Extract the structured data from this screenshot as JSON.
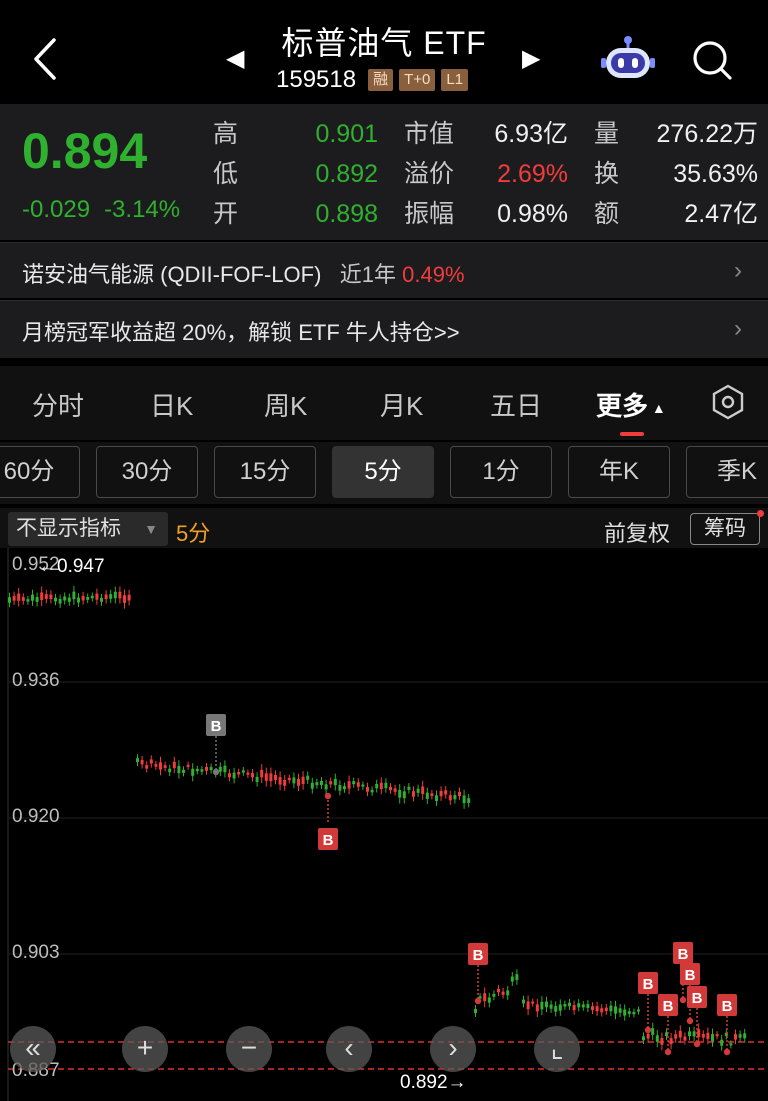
{
  "header": {
    "title": "标普油气 ETF",
    "code": "159518",
    "tags": [
      "融",
      "T+0",
      "L1"
    ]
  },
  "quote": {
    "price": "0.894",
    "change": "-0.029",
    "change_pct": "-3.14%",
    "high_label": "高",
    "high": "0.901",
    "low_label": "低",
    "low": "0.892",
    "open_label": "开",
    "open": "0.898",
    "mktcap_label": "市值",
    "mktcap": "6.93亿",
    "premium_label": "溢价",
    "premium": "2.69%",
    "amplitude_label": "振幅",
    "amplitude": "0.98%",
    "volume_label": "量",
    "volume": "276.22万",
    "turnover_label": "换",
    "turnover": "35.63%",
    "amount_label": "额",
    "amount": "2.47亿"
  },
  "fund_row": {
    "name": "诺安油气能源 (QDII-FOF-LOF)",
    "period": "近1年",
    "return": "0.49%"
  },
  "promo_row": {
    "text": "月榜冠军收益超 20%，解锁 ETF 牛人持仓>>"
  },
  "tabs": [
    "分时",
    "日K",
    "周K",
    "月K",
    "五日",
    "更多"
  ],
  "periods": [
    "60分",
    "30分",
    "15分",
    "5分",
    "1分",
    "年K",
    "季K"
  ],
  "subbar": {
    "indicator": "不显示指标",
    "period": "5分",
    "adjust": "前复权",
    "chips": "筹码"
  },
  "chart_data": {
    "type": "candlestick",
    "y_ticks": [
      "0.952",
      "0.936",
      "0.920",
      "0.903",
      "0.887"
    ],
    "ylim": [
      0.887,
      0.952
    ],
    "max_label": "←0.947",
    "min_label": "0.892→",
    "trade_marks": [
      "B",
      "B",
      "B",
      "B",
      "B",
      "B",
      "B",
      "B",
      "B"
    ],
    "colors": {
      "up": "#f23c3c",
      "down": "#2fb12f",
      "mark": "#d23a3a",
      "mark_gray": "#777777"
    }
  }
}
